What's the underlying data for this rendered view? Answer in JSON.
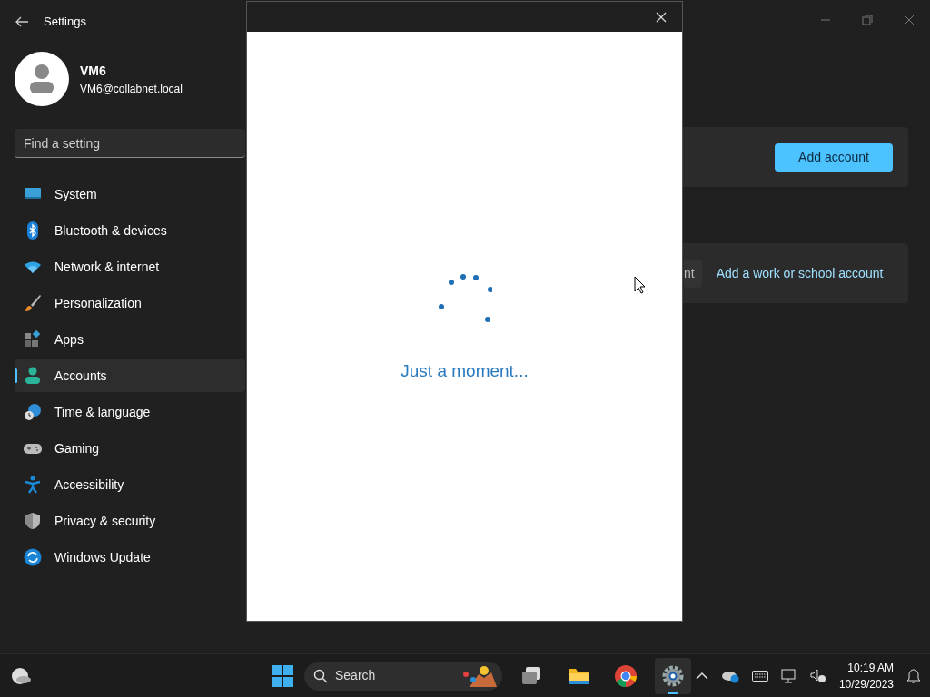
{
  "window": {
    "title": "Settings"
  },
  "user": {
    "name": "VM6",
    "email": "VM6@collabnet.local"
  },
  "search": {
    "placeholder": "Find a setting"
  },
  "nav": [
    {
      "label": "System",
      "kind": "system",
      "selected": false
    },
    {
      "label": "Bluetooth & devices",
      "kind": "bluetooth",
      "selected": false
    },
    {
      "label": "Network & internet",
      "kind": "wifi",
      "selected": false
    },
    {
      "label": "Personalization",
      "kind": "brush",
      "selected": false
    },
    {
      "label": "Apps",
      "kind": "apps",
      "selected": false
    },
    {
      "label": "Accounts",
      "kind": "person",
      "selected": true
    },
    {
      "label": "Time & language",
      "kind": "globe",
      "selected": false
    },
    {
      "label": "Gaming",
      "kind": "gamepad",
      "selected": false
    },
    {
      "label": "Accessibility",
      "kind": "access",
      "selected": false
    },
    {
      "label": "Privacy & security",
      "kind": "shield",
      "selected": false
    },
    {
      "label": "Windows Update",
      "kind": "update",
      "selected": false
    }
  ],
  "content": {
    "add_account_button": "Add account",
    "partial_button": "nt",
    "work_link": "Add a work or school account"
  },
  "dialog": {
    "message": "Just a moment..."
  },
  "taskbar": {
    "search": "Search",
    "apps": [
      {
        "kind": "taskview",
        "selected": false
      },
      {
        "kind": "folder",
        "selected": false
      },
      {
        "kind": "browser",
        "selected": false
      },
      {
        "kind": "gear",
        "selected": true
      }
    ],
    "time": "10:19 AM",
    "date": "10/29/2023"
  }
}
